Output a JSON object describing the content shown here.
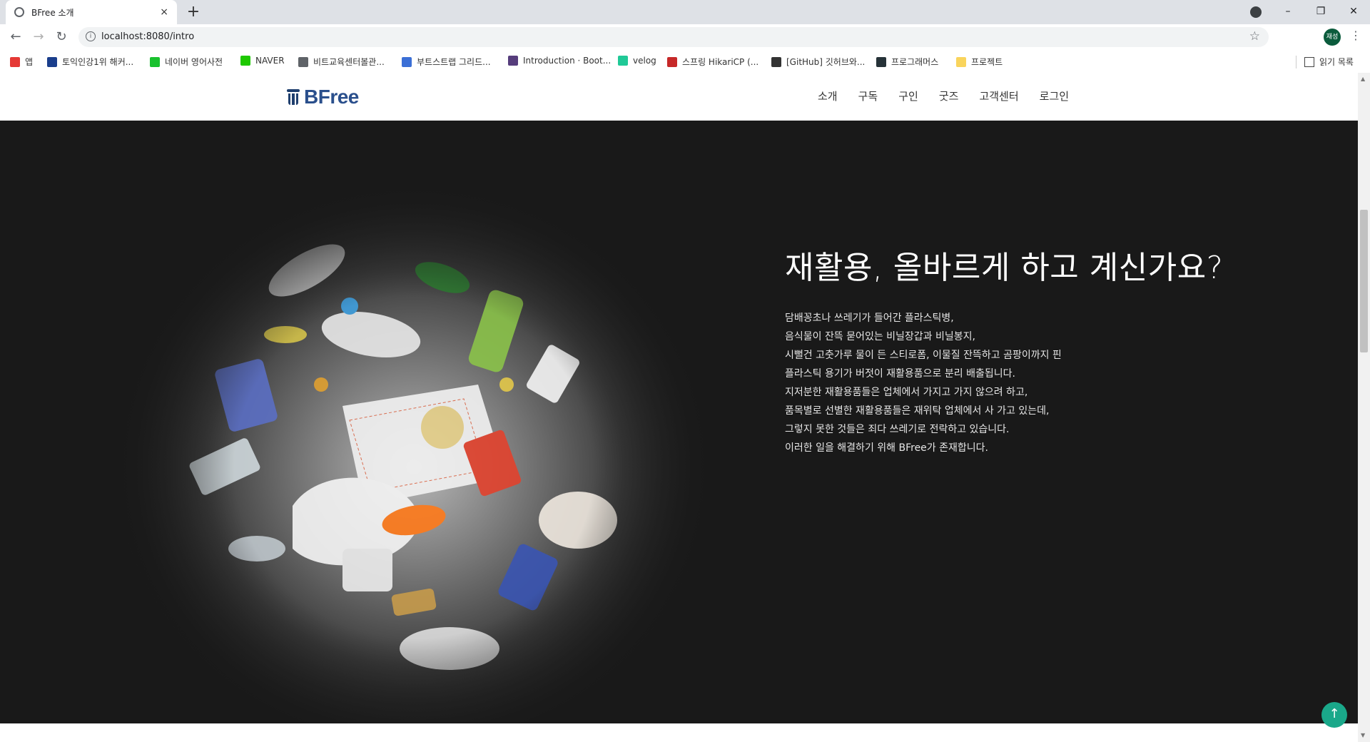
{
  "browser": {
    "tab_title": "BFree 소개",
    "url": "localhost:8080/intro",
    "new_tab": "+",
    "close_tab": "×",
    "avatar_label": "재성",
    "bookmarks": [
      {
        "label": "앱",
        "color": "#e53935"
      },
      {
        "label": "토익인강1위 해커...",
        "color": "#1a3e8c"
      },
      {
        "label": "네이버 영어사전",
        "color": "#19c12e"
      },
      {
        "label": "NAVER",
        "color": "#1ec800"
      },
      {
        "label": "비트교육센터볼관...",
        "color": "#5f6368"
      },
      {
        "label": "부트스트랩 그리드...",
        "color": "#3b6fd6"
      },
      {
        "label": "Introduction · Boot...",
        "color": "#563d7c"
      },
      {
        "label": "velog",
        "color": "#20c997"
      },
      {
        "label": "스프링 HikariCP (...",
        "color": "#c62828"
      },
      {
        "label": "[GitHub] 깃허브와...",
        "color": "#333333"
      },
      {
        "label": "프로그래머스",
        "color": "#263238"
      },
      {
        "label": "프로젝트",
        "color": "#f9d45c"
      }
    ],
    "reading_list": "읽기 목록"
  },
  "site": {
    "logo": "BFree",
    "nav": [
      "소개",
      "구독",
      "구인",
      "굿즈",
      "고객센터",
      "로그인"
    ]
  },
  "hero": {
    "heading": "재활용, 올바르게 하고 계신가요?",
    "lines": [
      "담배꽁초나 쓰레기가 들어간 플라스틱병,",
      "음식물이 잔뜩 묻어있는 비닐장갑과 비닐봉지,",
      "시뻘건 고춧가루 물이 든 스티로폼, 이물질 잔뜩하고 곰팡이까지 핀",
      "플라스틱 용기가 버젓이 재활용품으로 분리 배출됩니다.",
      "지저분한 재활용품들은 업체에서 가지고 가지 않으려 하고,",
      "품목별로 선별한 재활용품들은 재위탁 업체에서 사 가고 있는데,",
      "그렇지 못한 것들은 죄다 쓰레기로 전락하고 있습니다.",
      "이러한 일을 해결하기 위해 BFree가 존재합니다."
    ],
    "top_button": "↑"
  }
}
